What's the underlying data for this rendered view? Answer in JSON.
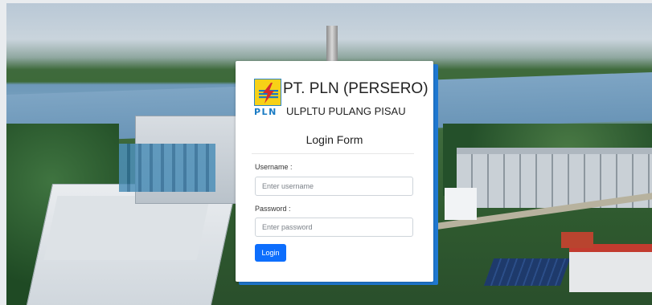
{
  "brand": {
    "title": "PT. PLN (PERSERO)",
    "subtitle": "ULPLTU PULANG PISAU",
    "logo_text": "PLN",
    "logo_colors": {
      "yellow": "#f7d117",
      "red": "#d62b2b",
      "blue": "#1a7bc4"
    }
  },
  "form": {
    "title": "Login Form",
    "username": {
      "label": "Username :",
      "placeholder": "Enter username",
      "value": ""
    },
    "password": {
      "label": "Password :",
      "placeholder": "Enter password",
      "value": ""
    },
    "submit_label": "Login"
  },
  "theme": {
    "accent": "#0d6efd",
    "card_shadow": "#1f78d1"
  }
}
